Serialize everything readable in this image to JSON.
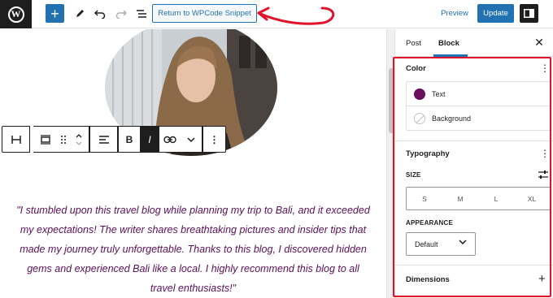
{
  "toolbar": {
    "return_label": "Return to WPCode Snippet",
    "preview_label": "Preview",
    "update_label": "Update"
  },
  "block_toolbar": {
    "bold_label": "B",
    "italic_label": "I"
  },
  "content": {
    "quote_lines": [
      "\"I stumbled upon this travel blog while planning my trip to Bali, and it exceeded",
      "my expectations! The writer shares breathtaking pictures and insider tips that",
      "made my journey truly unforgettable. Thanks to this blog, I discovered hidden",
      "gems and experienced Bali like a local. I highly recommend this blog to all",
      "travel enthusiasts!\""
    ]
  },
  "sidebar": {
    "tabs": [
      "Post",
      "Block"
    ],
    "active_tab": "Block",
    "color": {
      "title": "Color",
      "text_label": "Text",
      "text_swatch": "#6b0e5b",
      "background_label": "Background"
    },
    "typography": {
      "title": "Typography",
      "size_label": "SIZE",
      "sizes": [
        "S",
        "M",
        "L",
        "XL"
      ],
      "appearance_label": "APPEARANCE",
      "appearance_value": "Default"
    },
    "dimensions": {
      "title": "Dimensions"
    }
  },
  "colors": {
    "accent": "#2271b1",
    "annotation_red": "#e0132b",
    "quote_text": "#5b0f58"
  }
}
